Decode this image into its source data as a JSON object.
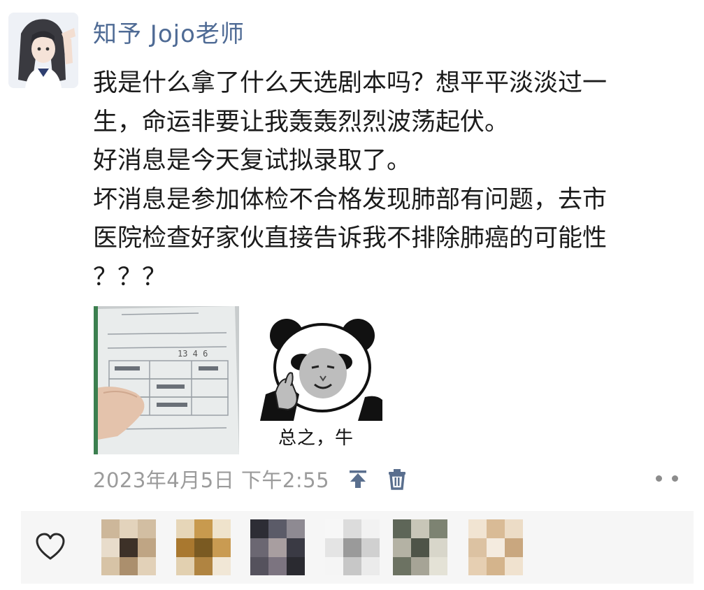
{
  "author": {
    "name": "知予 Jojo老师"
  },
  "post": {
    "lines": [
      "我是什么拿了什么天选剧本吗？想平平淡淡过一",
      "生，命运非要让我轰轰烈烈波荡起伏。",
      "好消息是今天复试拟录取了。",
      "坏消息是参加体检不合格发现肺部有问题，去市",
      "医院检查好家伙直接告诉我不排除肺癌的可能性",
      "？？？"
    ],
    "meme_caption": "总之，牛",
    "timestamp": "2023年4月5日 下午2:55"
  },
  "icons": {
    "pin": "pin-to-top-icon",
    "trash": "trash-icon",
    "more": "more-dots-icon",
    "heart": "heart-icon"
  },
  "colors": {
    "author": "#4f6b95",
    "text": "#1b1b1b",
    "meta": "#9b9b9b",
    "action_icon": "#5a6f8e",
    "likes_bg": "#f6f6f6"
  }
}
